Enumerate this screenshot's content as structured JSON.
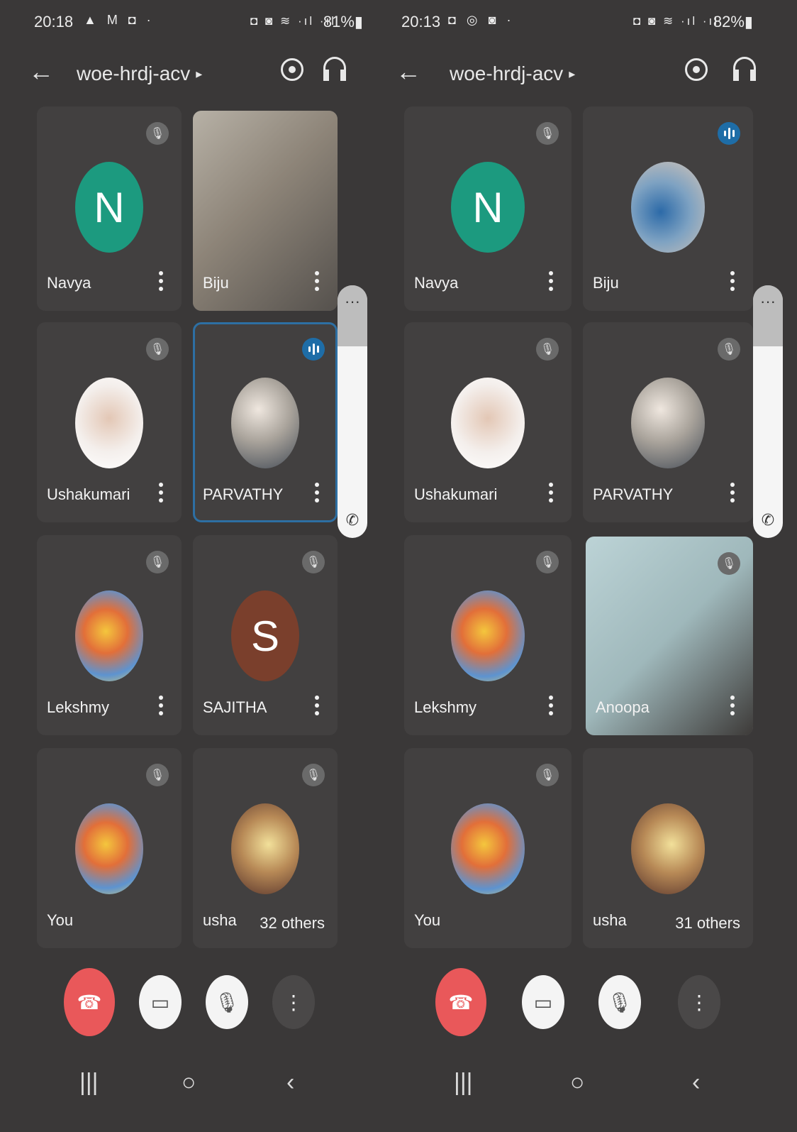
{
  "phones": [
    {
      "status": {
        "time": "20:18",
        "icons_left": "▲ M ◘ ·",
        "icons_right": "◘ ◙ ≋ ·ıl ·ıl",
        "battery": "81%▮"
      },
      "title": "woe-hrdj-acv",
      "tiles": {
        "navya": "Navya",
        "biju": "Biju",
        "ushakumari": "Ushakumari",
        "parvathy": "PARVATHY",
        "lekshmy": "Lekshmy",
        "sajitha": "SAJITHA",
        "you": "You",
        "usha": "usha",
        "others": "32 others"
      },
      "avatar_letters": {
        "navya": "N",
        "sajitha": "S"
      }
    },
    {
      "status": {
        "time": "20:13",
        "icons_left": "◘ ◎ ◙ ·",
        "icons_right": "◘ ◙ ≋ ·ıl ·ıl",
        "battery": "82%▮"
      },
      "title": "woe-hrdj-acv",
      "tiles": {
        "navya": "Navya",
        "biju": "Biju",
        "ushakumari": "Ushakumari",
        "parvathy": "PARVATHY",
        "lekshmy": "Lekshmy",
        "anoopa": "Anoopa",
        "you": "You",
        "usha": "usha",
        "others": "31 others"
      },
      "avatar_letters": {
        "navya": "N"
      }
    }
  ],
  "icons": {
    "back": "←",
    "caret": "▸",
    "mic_off": "🎙",
    "pill_more": "···",
    "pill_phone": "✆",
    "hangup": "☎",
    "camera_off": "▭",
    "mic_toggle": "🎙",
    "more": "⋮",
    "nav_recents": "|||",
    "nav_home": "○",
    "nav_back": "‹"
  },
  "colors": {
    "background": "#3a3838",
    "tile": "#424040",
    "avatar_n": "#1c9a7f",
    "avatar_s": "#7a3f2c",
    "speaking": "#1e6da7",
    "hangup": "#e9585a"
  }
}
